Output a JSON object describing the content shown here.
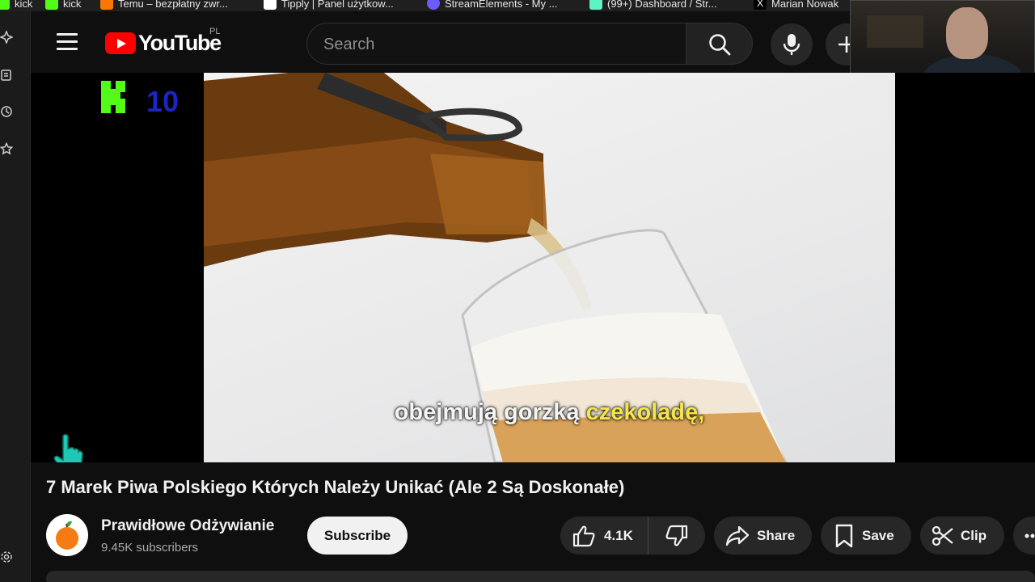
{
  "bookmarks": [
    {
      "label": "kick",
      "icon": "kick-icon",
      "color": "#53fc18"
    },
    {
      "label": "kick",
      "icon": "kick-icon",
      "color": "#53fc18"
    },
    {
      "label": "Temu – bezpłatny zwr...",
      "icon": "temu-icon",
      "color": "#fb7701"
    },
    {
      "label": "Tipply | Panel użytkow...",
      "icon": "tipply-icon",
      "color": "#ffffff"
    },
    {
      "label": "StreamElements - My ...",
      "icon": "streamelements-icon",
      "color": "#6a5cff"
    },
    {
      "label": "(99+) Dashboard / Str...",
      "icon": "twitch-icon",
      "color": "#5df3c5"
    },
    {
      "label": "Marian Nowak",
      "icon": "x-icon",
      "color": "#ffffff"
    }
  ],
  "header": {
    "logo_text": "YouTube",
    "region": "PL",
    "search_placeholder": "Search"
  },
  "player": {
    "channel_watermark": "10",
    "subtitle_main": "obejmują gorzką",
    "subtitle_highlight": "czekoladę,"
  },
  "video": {
    "title": "7 Marek Piwa Polskiego Których Należy Unikać (Ale 2 Są Doskonałe)",
    "channel_name": "Prawidłowe Odżywianie",
    "subscribers": "9.45K subscribers",
    "subscribe_label": "Subscribe",
    "likes": "4.1K",
    "share_label": "Share",
    "save_label": "Save",
    "clip_label": "Clip"
  },
  "colors": {
    "background": "#0f0f0f",
    "brand_red": "#ff0000",
    "subtitle_highlight": "#f4e64a",
    "kick_green": "#53fc18"
  }
}
